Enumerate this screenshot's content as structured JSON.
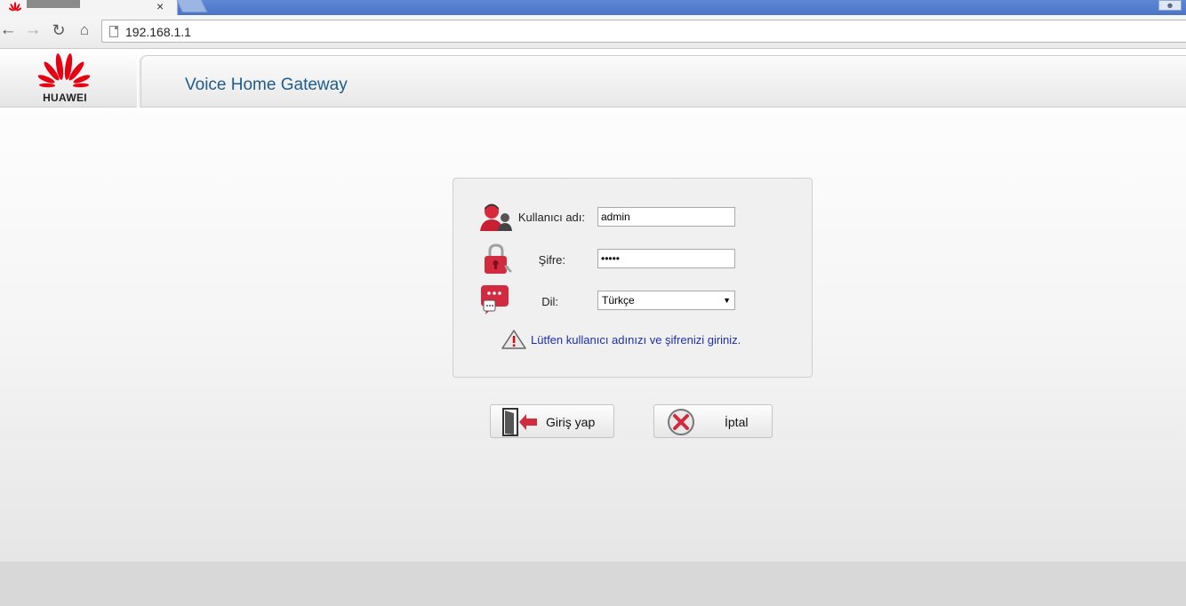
{
  "browser": {
    "tab_close": "×",
    "url": "192.168.1.1"
  },
  "header": {
    "brand": "HUAWEI",
    "title": "Voice Home Gateway"
  },
  "login": {
    "username_label": "Kullanıcı adı:",
    "username_value": "admin",
    "password_label": "Şifre:",
    "password_value": "•••••",
    "language_label": "Dil:",
    "language_selected": "Türkçe",
    "hint": "Lütfen kullanıcı adınızı ve şifrenizi giriniz."
  },
  "buttons": {
    "login": "Giriş yap",
    "cancel": "İptal"
  },
  "colors": {
    "brand_red": "#e60012",
    "title_blue": "#1d5c8c",
    "hint_blue": "#1b2fa8"
  },
  "icons": [
    "huawei-logo-icon",
    "user-icon",
    "padlock-icon",
    "speech-bubble-icon",
    "warning-icon",
    "login-door-icon",
    "cancel-x-icon"
  ]
}
